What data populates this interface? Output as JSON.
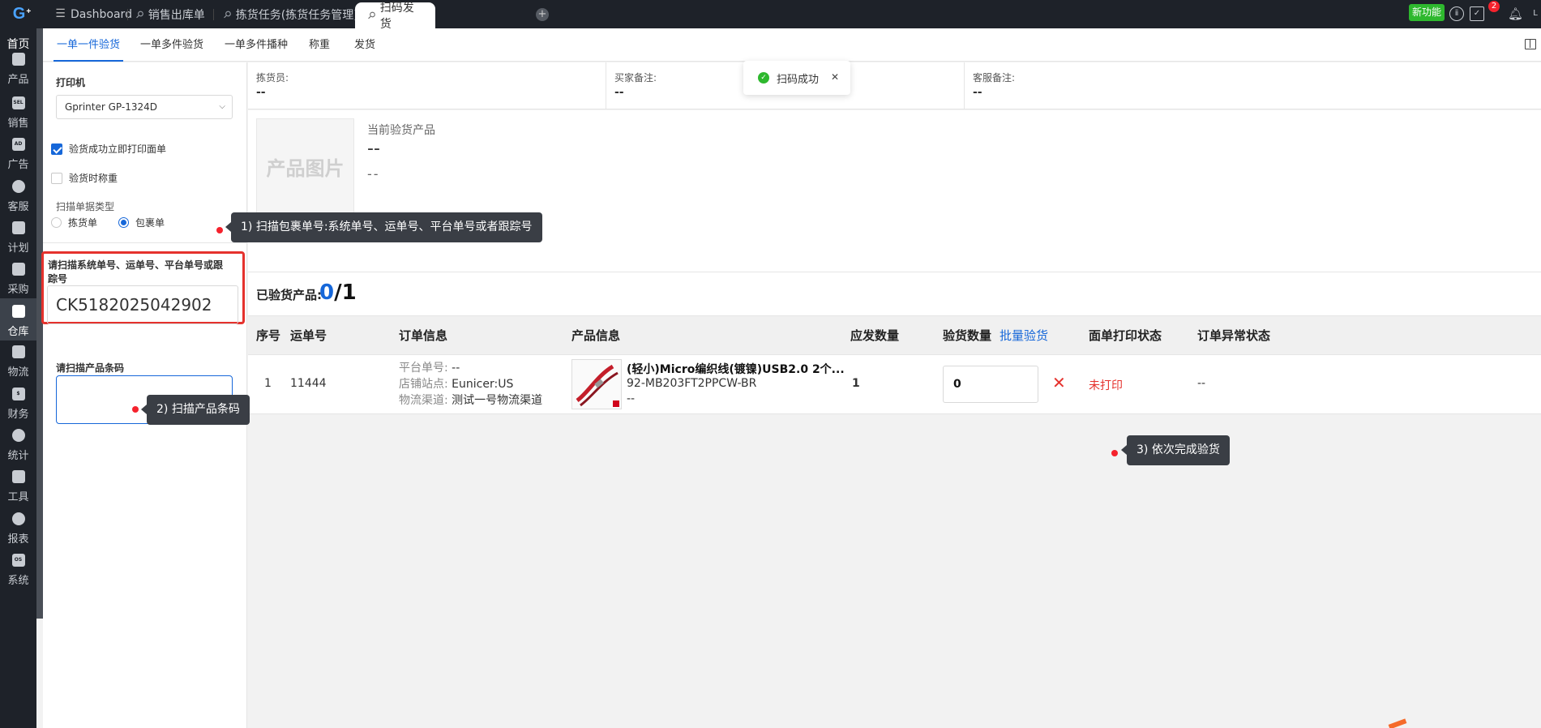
{
  "topbar": {
    "logo": "G",
    "tabs": [
      {
        "label": "Dashboard"
      },
      {
        "label": "销售出库单"
      },
      {
        "label": "拣货任务(拣货任务管理)"
      },
      {
        "label": "扫码发货"
      }
    ],
    "add_tab": "+",
    "new_feature": "新功能",
    "notification_count": "2"
  },
  "leftnav": {
    "home": "首页",
    "items": [
      {
        "label": "产品",
        "icon": "box-icon"
      },
      {
        "label": "销售",
        "icon": "sale-icon"
      },
      {
        "label": "广告",
        "icon": "ad-icon"
      },
      {
        "label": "客服",
        "icon": "chat-icon"
      },
      {
        "label": "计划",
        "icon": "plan-icon"
      },
      {
        "label": "采购",
        "icon": "cart-icon"
      },
      {
        "label": "仓库",
        "icon": "warehouse-icon"
      },
      {
        "label": "物流",
        "icon": "truck-icon"
      },
      {
        "label": "财务",
        "icon": "money-icon"
      },
      {
        "label": "统计",
        "icon": "stats-icon"
      },
      {
        "label": "工具",
        "icon": "tool-icon"
      },
      {
        "label": "报表",
        "icon": "report-icon"
      },
      {
        "label": "系统",
        "icon": "system-icon"
      }
    ]
  },
  "subtabs": [
    "一单一件验货",
    "一单多件验货",
    "一单多件播种",
    "称重",
    "发货"
  ],
  "form": {
    "printer_label": "打印机",
    "printer_value": "Gprinter GP-1324D",
    "print_on_success": "验货成功立即打印面单",
    "weigh_on_check": "验货时称重",
    "scan_type_label": "扫描单据类型",
    "scan_type_options": [
      "拣货单",
      "包裹单"
    ],
    "scan_order_label": "请扫描系统单号、运单号、平台单号或跟踪号",
    "scan_order_value": "CK5182025042902",
    "scan_barcode_label": "请扫描产品条码"
  },
  "info": {
    "picker_label": "拣货员:",
    "picker_value": "--",
    "buyer_note_label": "买家备注:",
    "buyer_note_value": "--",
    "cs_note_label": "客服备注:",
    "cs_note_value": "--"
  },
  "current_product": {
    "image_placeholder": "产品图片",
    "label": "当前验货产品",
    "line1": "--",
    "line2": "--"
  },
  "checked": {
    "label": "已验货产品:",
    "done": "0",
    "total": "/1"
  },
  "table": {
    "headers": [
      "序号",
      "运单号",
      "订单信息",
      "产品信息",
      "应发数量",
      "验货数量",
      "面单打印状态",
      "订单异常状态"
    ],
    "batch_check": "批量验货",
    "row": {
      "index": "1",
      "waybill": "11444",
      "platform_order_label": "平台单号:",
      "platform_order_value": "--",
      "store_label": "店铺站点:",
      "store_value": "Eunicer:US",
      "channel_label": "物流渠道:",
      "channel_value": "测试一号物流渠道",
      "product_name": "(轻小)Micro编织线(镀镍)USB2.0 2个...",
      "sku": "92-MB203FT2PPCW-BR",
      "product_extra": "--",
      "qty_expected": "1",
      "qty_checked": "0",
      "print_status": "未打印",
      "exception_status": "--"
    }
  },
  "tooltips": {
    "step1": "1) 扫描包裹单号:系统单号、运单号、平台单号或者跟踪号",
    "step2": "2) 扫描产品条码",
    "step3": "3) 依次完成验货"
  },
  "toast": {
    "message": "扫码成功"
  },
  "colors": {
    "accent": "#1667d9",
    "danger": "#e5322d",
    "success": "#2eb82e",
    "nav_bg": "#1e2229"
  }
}
